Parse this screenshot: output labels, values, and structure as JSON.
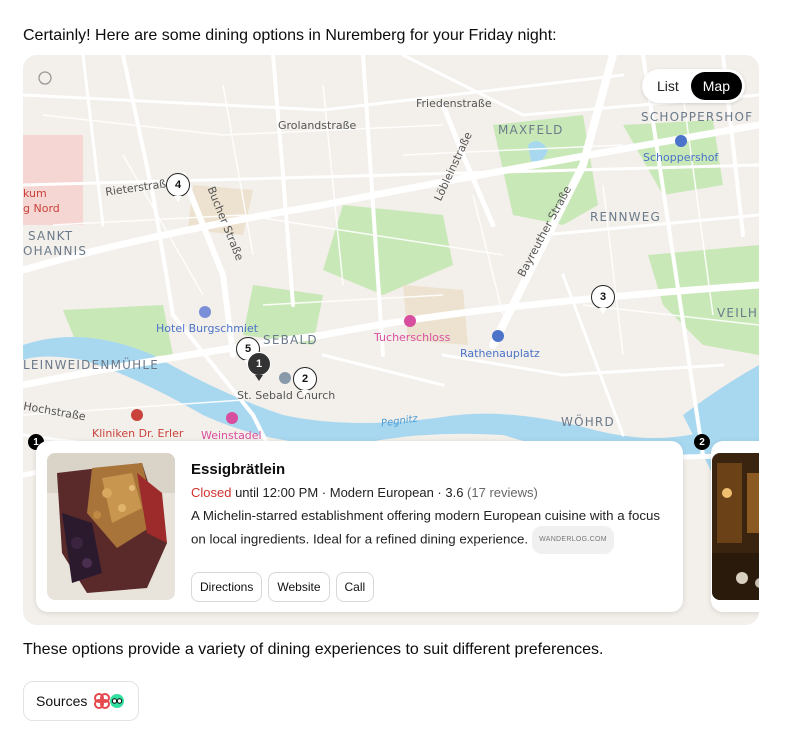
{
  "intro_text": "Certainly! Here are some dining options in Nuremberg for your Friday night:",
  "outro_text": "These options provide a variety of dining experiences to suit different preferences.",
  "view_toggle": {
    "list_label": "List",
    "map_label": "Map",
    "active": "Map"
  },
  "map": {
    "street_labels": [
      "Friedenstraße",
      "Grolandstraße",
      "Rieterstraße",
      "Bucher Straße",
      "Löbleinstraße",
      "Bayreuther Straße",
      "Hochstraße"
    ],
    "district_labels": [
      "MAXFELD",
      "SCHOPPERSHOF",
      "RENNWEG",
      "SANKT",
      "OHANNIS",
      "SEBALD",
      "LEINWEIDENMÜHLE",
      "WÖHRD",
      "VEILH"
    ],
    "poi_labels": {
      "schoppershof": "Schoppershof",
      "hotel": "Hotel Burgschmiet",
      "tucherschloss": "Tucherschloss",
      "rathenauplatz": "Rathenauplatz",
      "church": "St. Sebald Church",
      "kliniken": "Kliniken Dr. Erler",
      "weinstadel": "Weinstadel",
      "museum_line1": "kum",
      "museum_line2": "g Nord",
      "river": "Pegnitz"
    },
    "markers": [
      "1",
      "2",
      "3",
      "4",
      "5"
    ]
  },
  "cards": [
    {
      "index": "1",
      "name": "Essigbrätlein",
      "status": "Closed",
      "meta_rest": " until 12:00 PM · Modern European · 3.6 ",
      "reviews": "(17 reviews)",
      "description": "A Michelin-starred establishment offering modern European cuisine with a focus on local ingredients. Ideal for a refined dining experience.",
      "source_chip": "WANDERLOG.COM",
      "actions": [
        "Directions",
        "Website",
        "Call"
      ]
    },
    {
      "index": "2"
    }
  ],
  "sources_label": "Sources",
  "colors": {
    "closed": "#d0312d",
    "park": "#c9e8b8",
    "water": "#a8d8f0",
    "road": "#ffffff",
    "land": "#f3efea"
  }
}
